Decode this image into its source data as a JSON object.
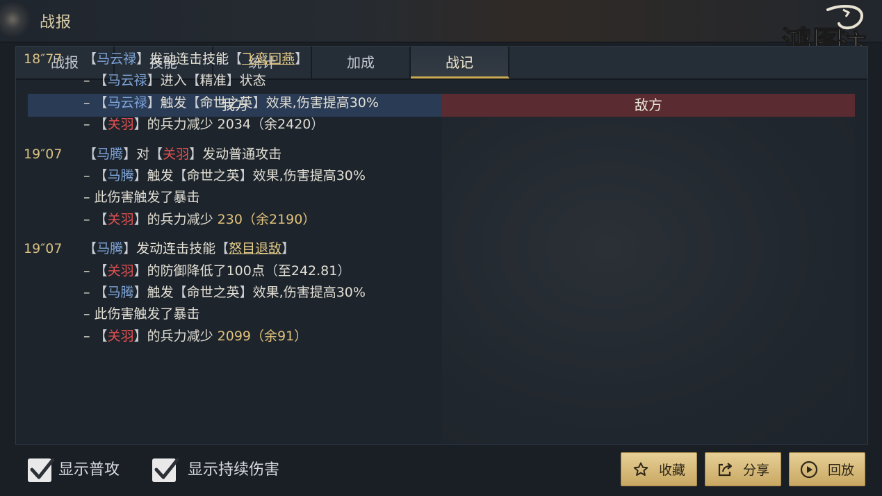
{
  "header": {
    "title": "战报"
  },
  "tabs": [
    {
      "label": "战报"
    },
    {
      "label": "技能"
    },
    {
      "label": "统计"
    },
    {
      "label": "加成"
    },
    {
      "label": "战记",
      "active": true
    }
  ],
  "columns": {
    "ally": "我方",
    "enemy": "敌方"
  },
  "log": {
    "e1": {
      "time": "18″77",
      "actor": "马云禄",
      "action": "发动连击技能",
      "skill": "飞鸾回燕"
    },
    "e1s1": {
      "dash": "–",
      "target": "马云禄",
      "text1": "进入",
      "state": "精准",
      "text2": "状态"
    },
    "e1s2": {
      "dash": "–",
      "target": "马云禄",
      "text1": "触发",
      "effect": "命世之英",
      "text2": "效果,伤害提高30%"
    },
    "e1s3": {
      "dash": "–",
      "target": "关羽",
      "text1": "的兵力减少",
      "amount": "2034",
      "remain": "余2420"
    },
    "e2": {
      "time": "19″07",
      "actor": "马腾",
      "mid": "对",
      "target": "关羽",
      "action": "发动普通攻击"
    },
    "e2s1": {
      "dash": "–",
      "target": "马腾",
      "text1": "触发",
      "effect": "命世之英",
      "text2": "效果,伤害提高30%"
    },
    "e2s2": {
      "text": "– 此伤害触发了暴击"
    },
    "e2s3": {
      "dash": "–",
      "target": "关羽",
      "text1": "的兵力减少",
      "amount": "230",
      "remain": "余2190"
    },
    "e3": {
      "time": "19″07",
      "actor": "马腾",
      "action": "发动连击技能",
      "skill": "怒目退敌"
    },
    "e3s1": {
      "dash": "–",
      "target": "关羽",
      "text1": "的防御降低了100点",
      "detail": "至242.81"
    },
    "e3s2": {
      "dash": "–",
      "target": "马腾",
      "text1": "触发",
      "effect": "命世之英",
      "text2": "效果,伤害提高30%"
    },
    "e3s3": {
      "text": "– 此伤害触发了暴击"
    },
    "e3s4": {
      "dash": "–",
      "target": "关羽",
      "text1": "的兵力减少",
      "amount": "2099",
      "remain": "余91"
    }
  },
  "options": {
    "show_normal": "显示普攻",
    "show_dot": "显示持续伤害"
  },
  "buttons": {
    "favorite": "收藏",
    "share": "分享",
    "replay": "回放"
  },
  "colors": {
    "ally_name": "#7fa5d9",
    "enemy_name": "#e05050",
    "gold": "#e2c27a"
  }
}
